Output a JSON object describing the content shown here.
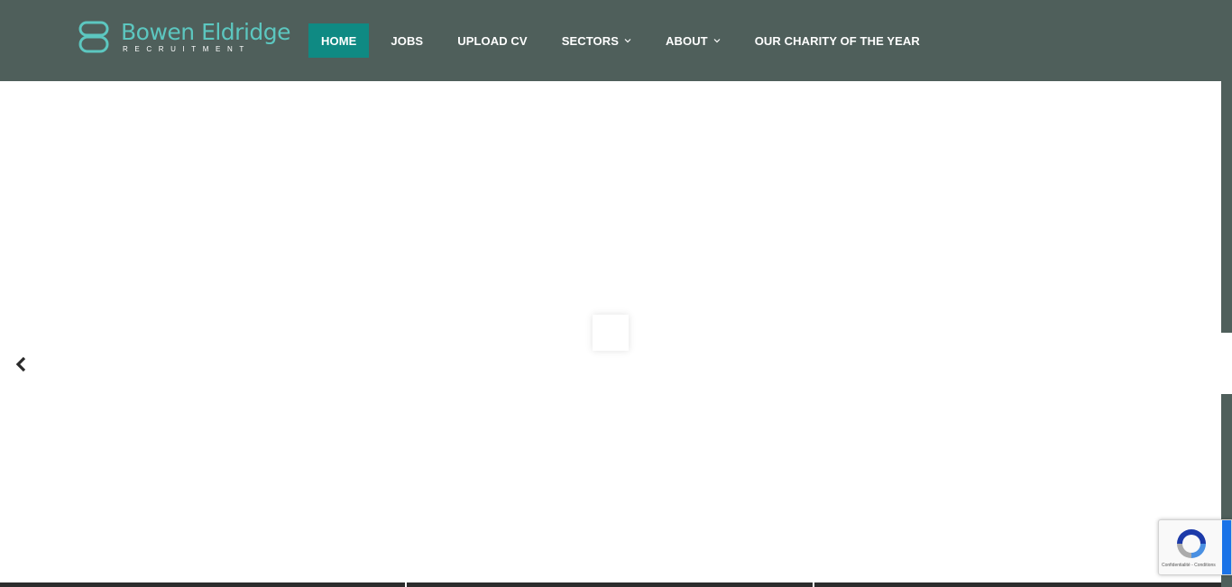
{
  "header": {
    "logo": {
      "name": "Bowen Eldridge",
      "subtitle": "RECRUITMENT"
    },
    "nav": [
      {
        "label": "HOME",
        "active": true
      },
      {
        "label": "JOBS",
        "active": false
      },
      {
        "label": "UPLOAD CV",
        "active": false
      },
      {
        "label": "SECTORS",
        "active": false,
        "dropdown": true
      },
      {
        "label": "ABOUT",
        "active": false,
        "dropdown": true
      },
      {
        "label": "OUR CHARITY OF THE YEAR",
        "active": false
      }
    ]
  },
  "colors": {
    "header_bg": "#4f5f5b",
    "accent": "#0f8a83",
    "logo_teal": "#5cc7c0"
  },
  "slider": {
    "prev_icon": "chevron-left-icon"
  },
  "recaptcha": {
    "links": "Confidentialité - Conditions"
  }
}
